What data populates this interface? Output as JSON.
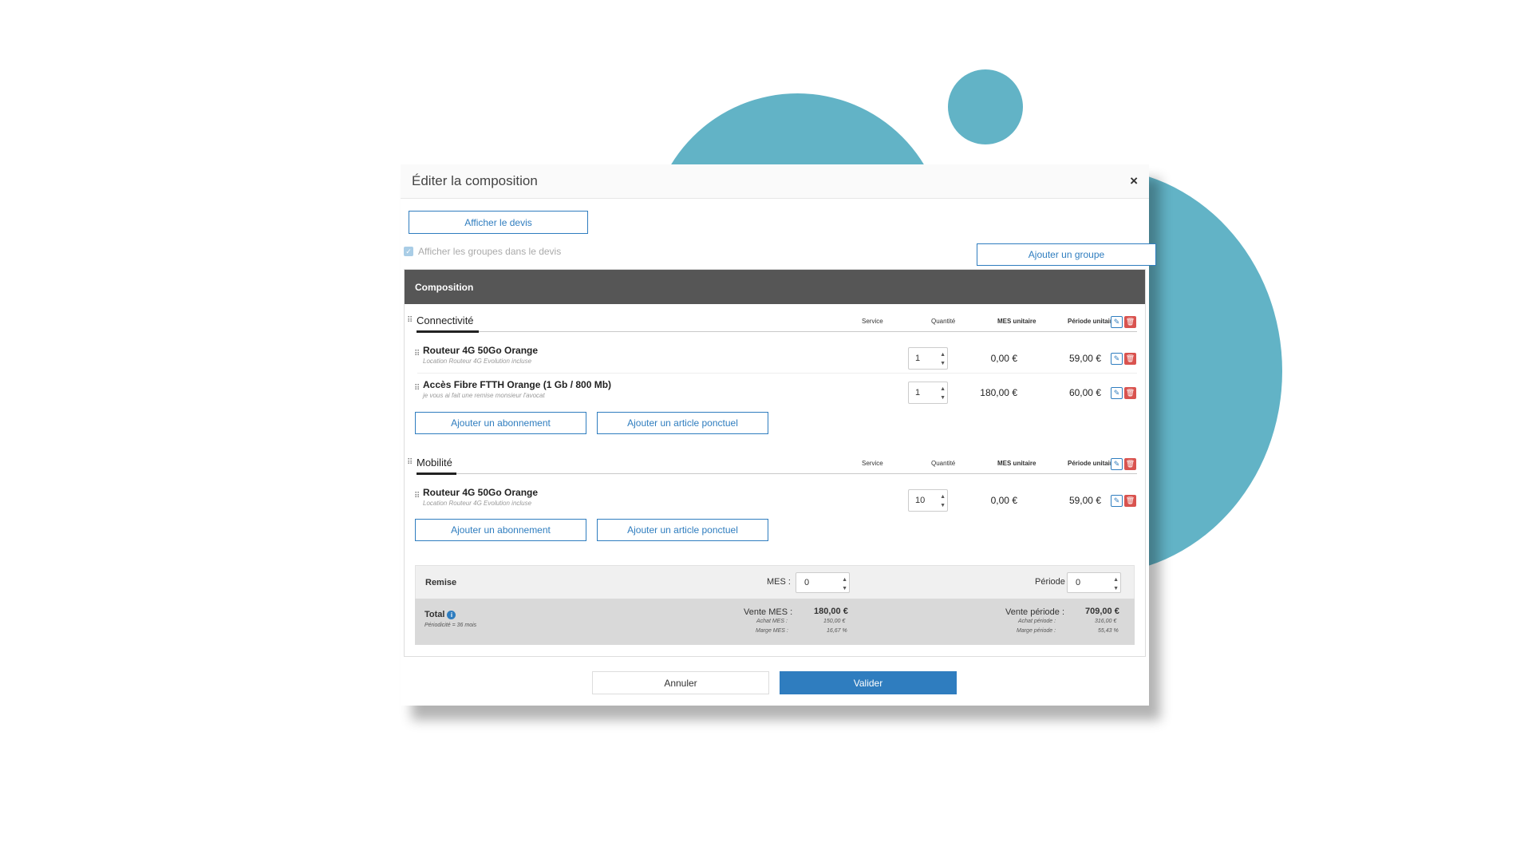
{
  "modal": {
    "title": "Éditer la composition",
    "close_icon": "×"
  },
  "toolbar": {
    "show_quote": "Afficher le devis",
    "show_groups_label": "Afficher les groupes dans le devis",
    "show_groups_checked": true,
    "add_group": "Ajouter un groupe"
  },
  "panel_title": "Composition",
  "columns": {
    "service": "Service",
    "quantity": "Quantité",
    "mes_unit": "MES unitaire",
    "period_unit": "Période unitaire"
  },
  "groups": [
    {
      "name": "Connectivité",
      "items": [
        {
          "name": "Routeur 4G 50Go Orange",
          "desc": "Location Routeur 4G Evolution incluse",
          "qty": "1",
          "mes": "0,00 €",
          "period": "59,00 €"
        },
        {
          "name": "Accès Fibre FTTH Orange (1 Gb / 800 Mb)",
          "desc": "je vous ai fait une remise monsieur l'avocat",
          "qty": "1",
          "mes": "180,00 €",
          "period": "60,00 €"
        }
      ],
      "add_subscription": "Ajouter un abonnement",
      "add_one_off": "Ajouter un article ponctuel"
    },
    {
      "name": "Mobilité",
      "items": [
        {
          "name": "Routeur 4G 50Go Orange",
          "desc": "Location Routeur 4G Evolution incluse",
          "qty": "10",
          "mes": "0,00 €",
          "period": "59,00 €"
        }
      ],
      "add_subscription": "Ajouter un abonnement",
      "add_one_off": "Ajouter un article ponctuel"
    }
  ],
  "discount": {
    "label": "Remise",
    "mes_label": "MES :",
    "mes_value": "0",
    "period_label": "Période :",
    "period_value": "0"
  },
  "total": {
    "label": "Total",
    "periodicity": "Périodicité = 36 mois",
    "vente_mes_label": "Vente MES :",
    "vente_mes": "180,00 €",
    "achat_mes_label": "Achat MES :",
    "achat_mes": "150,00 €",
    "marge_mes_label": "Marge MES :",
    "marge_mes": "16,67 %",
    "vente_period_label": "Vente période :",
    "vente_period": "709,00 €",
    "achat_period_label": "Achat période :",
    "achat_period": "316,00 €",
    "marge_period_label": "Marge période :",
    "marge_period": "55,43 %"
  },
  "footer": {
    "cancel": "Annuler",
    "validate": "Valider"
  },
  "colors": {
    "accent": "#2f7dbf",
    "danger": "#d9534f",
    "decor": "#62b3c6",
    "header_bar": "#565656"
  }
}
